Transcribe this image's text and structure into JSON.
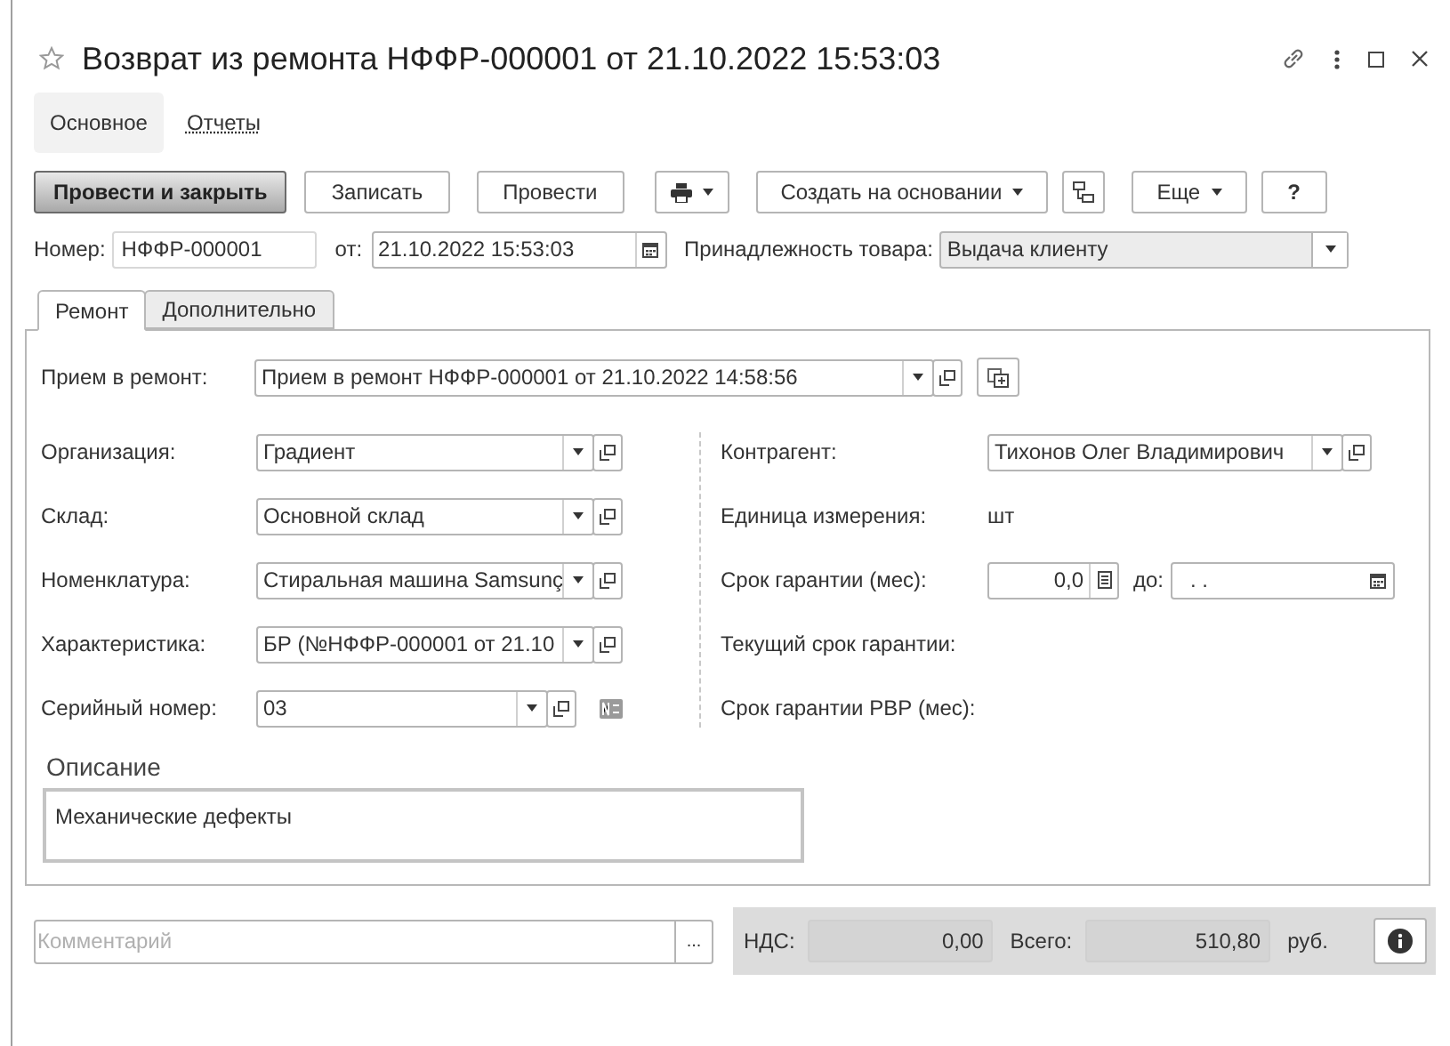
{
  "window": {
    "title": "Возврат из ремонта НФФР-000001 от 21.10.2022 15:53:03",
    "favorite": false
  },
  "nav": [
    {
      "label": "Основное",
      "selected": true
    },
    {
      "label": "Отчеты",
      "selected": false
    }
  ],
  "toolbar": [
    {
      "kind": "primary",
      "label": "Провести и закрыть"
    },
    {
      "kind": "button",
      "label": "Записать"
    },
    {
      "kind": "button",
      "label": "Провести"
    },
    {
      "kind": "print"
    },
    {
      "kind": "menu",
      "label": "Создать на основании"
    },
    {
      "kind": "structure"
    },
    {
      "kind": "menu",
      "label": "Еще"
    },
    {
      "kind": "button",
      "label": "?"
    }
  ],
  "header": {
    "number_label": "Номер:",
    "number": "НФФР-000001",
    "date_label": "от:",
    "date": "21.10.2022 15:53:03",
    "ownership_label": "Принадлежность товара:",
    "ownership": "Выдача клиенту"
  },
  "tabs": [
    {
      "label": "Ремонт",
      "selected": true
    },
    {
      "label": "Дополнительно",
      "selected": false
    }
  ],
  "receipt": {
    "label": "Прием в ремонт:",
    "value": "Прием в ремонт НФФР-000001 от 21.10.2022 14:58:56"
  },
  "left_fields": [
    {
      "label": "Организация:",
      "value": "Градиент",
      "kind": "select"
    },
    {
      "label": "Склад:",
      "value": "Основной склад",
      "kind": "select"
    },
    {
      "label": "Номенклатура:",
      "value": "Стиральная машина Samsunç",
      "kind": "select"
    },
    {
      "label": "Характеристика:",
      "value": "БР (№НФФР-000001 от 21.10",
      "kind": "select"
    },
    {
      "label": "Серийный номер:",
      "value": "03",
      "kind": "serial"
    }
  ],
  "right_fields": [
    {
      "label": "Контрагент:",
      "value": "Тихонов Олег Владимирович",
      "kind": "select"
    },
    {
      "label": "Единица измерения:",
      "value": "шт",
      "kind": "text"
    },
    {
      "label": "Срок гарантии (мес):",
      "value": "0,0",
      "kind": "warranty",
      "until_label": "до:",
      "until_value": ". ."
    },
    {
      "label": "Текущий срок гарантии:",
      "kind": "label"
    },
    {
      "label": "Срок гарантии РВР (мес):",
      "kind": "label"
    }
  ],
  "description": {
    "label": "Описание",
    "value": "Механические дефекты"
  },
  "comment": {
    "placeholder": "Комментарий",
    "button": "..."
  },
  "totals": {
    "vat_label": "НДС:",
    "vat": "0,00",
    "total_label": "Всего:",
    "total": "510,80",
    "currency": "руб."
  }
}
